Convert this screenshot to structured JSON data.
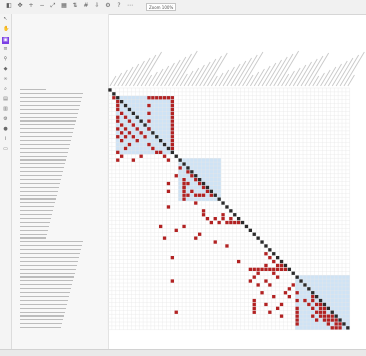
{
  "toolbar": {
    "zoom_value": "Zoom 100%",
    "buttons": [
      "select-icon",
      "pan-icon",
      "zoom-in-icon",
      "zoom-out-icon",
      "fit-icon",
      "cluster-icon",
      "sort-icon",
      "grid-icon",
      "export-icon",
      "settings-icon",
      "help-icon",
      "more-icon"
    ]
  },
  "sidebar": {
    "icons": [
      "pointer-icon",
      "hand-icon",
      "matrix-icon",
      "layers-icon",
      "filter-icon",
      "tag-icon",
      "link-icon",
      "search-icon",
      "chart-icon",
      "table-icon",
      "gear-icon",
      "user-icon",
      "info-icon",
      "folder-icon"
    ],
    "active_index": 2
  },
  "status": {
    "text": ""
  },
  "colors": {
    "mark": "#b22222",
    "diagonal": "#2b2b2b",
    "cluster": "#cfe3f5",
    "grid": "#e7e7e7"
  },
  "matrix": {
    "n": 62,
    "marks": [
      [
        2,
        1
      ],
      [
        3,
        2
      ],
      [
        4,
        2
      ],
      [
        5,
        2
      ],
      [
        6,
        3
      ],
      [
        7,
        2
      ],
      [
        7,
        4
      ],
      [
        8,
        2
      ],
      [
        8,
        5
      ],
      [
        9,
        3
      ],
      [
        9,
        6
      ],
      [
        10,
        2
      ],
      [
        10,
        4
      ],
      [
        10,
        7
      ],
      [
        11,
        3
      ],
      [
        11,
        5
      ],
      [
        11,
        8
      ],
      [
        12,
        2
      ],
      [
        12,
        4
      ],
      [
        12,
        6
      ],
      [
        12,
        9
      ],
      [
        13,
        3
      ],
      [
        13,
        7
      ],
      [
        14,
        5
      ],
      [
        14,
        10
      ],
      [
        15,
        4
      ],
      [
        15,
        11
      ],
      [
        16,
        2
      ],
      [
        16,
        12
      ],
      [
        16,
        13
      ],
      [
        17,
        3
      ],
      [
        17,
        8
      ],
      [
        17,
        14
      ],
      [
        18,
        2
      ],
      [
        18,
        6
      ],
      [
        18,
        15
      ],
      [
        10,
        10
      ],
      [
        8,
        10
      ],
      [
        6,
        10
      ],
      [
        4,
        10
      ],
      [
        2,
        10
      ],
      [
        2,
        11
      ],
      [
        2,
        12
      ],
      [
        2,
        13
      ],
      [
        2,
        14
      ],
      [
        2,
        15
      ],
      [
        2,
        16
      ],
      [
        3,
        16
      ],
      [
        4,
        16
      ],
      [
        5,
        16
      ],
      [
        6,
        16
      ],
      [
        7,
        16
      ],
      [
        8,
        16
      ],
      [
        9,
        16
      ],
      [
        10,
        16
      ],
      [
        11,
        16
      ],
      [
        12,
        16
      ],
      [
        13,
        16
      ],
      [
        14,
        16
      ],
      [
        15,
        16
      ],
      [
        21,
        20
      ],
      [
        22,
        21
      ],
      [
        23,
        19
      ],
      [
        23,
        22
      ],
      [
        24,
        20
      ],
      [
        24,
        23
      ],
      [
        25,
        19
      ],
      [
        25,
        24
      ],
      [
        26,
        21
      ],
      [
        26,
        25
      ],
      [
        27,
        19
      ],
      [
        27,
        20
      ],
      [
        27,
        26
      ],
      [
        26,
        19
      ],
      [
        25,
        19
      ],
      [
        24,
        19
      ],
      [
        27,
        22
      ],
      [
        27,
        23
      ],
      [
        27,
        24
      ],
      [
        20,
        18
      ],
      [
        22,
        17
      ],
      [
        24,
        15
      ],
      [
        26,
        15
      ],
      [
        28,
        19
      ],
      [
        29,
        22
      ],
      [
        30,
        15
      ],
      [
        31,
        24
      ],
      [
        32,
        24
      ],
      [
        32,
        29
      ],
      [
        33,
        25
      ],
      [
        33,
        31
      ],
      [
        34,
        26
      ],
      [
        34,
        32
      ],
      [
        33,
        27
      ],
      [
        34,
        28
      ],
      [
        33,
        29
      ],
      [
        34,
        30
      ],
      [
        34,
        31
      ],
      [
        34,
        33
      ],
      [
        35,
        19
      ],
      [
        37,
        23
      ],
      [
        38,
        22
      ],
      [
        39,
        27
      ],
      [
        40,
        30
      ],
      [
        36,
        17
      ],
      [
        43,
        41
      ],
      [
        42,
        40
      ],
      [
        44,
        42
      ],
      [
        45,
        40
      ],
      [
        45,
        43
      ],
      [
        45,
        44
      ],
      [
        46,
        41
      ],
      [
        47,
        38
      ],
      [
        48,
        37
      ],
      [
        49,
        36
      ],
      [
        46,
        36
      ],
      [
        46,
        37
      ],
      [
        46,
        38
      ],
      [
        46,
        39
      ],
      [
        46,
        40
      ],
      [
        46,
        42
      ],
      [
        46,
        43
      ],
      [
        46,
        44
      ],
      [
        46,
        45
      ],
      [
        44,
        33
      ],
      [
        47,
        42
      ],
      [
        48,
        43
      ],
      [
        49,
        40
      ],
      [
        50,
        41
      ],
      [
        51,
        46
      ],
      [
        52,
        45
      ],
      [
        53,
        46
      ],
      [
        54,
        50
      ],
      [
        55,
        51
      ],
      [
        56,
        52
      ],
      [
        57,
        53
      ],
      [
        55,
        53
      ],
      [
        56,
        54
      ],
      [
        57,
        54
      ],
      [
        57,
        55
      ],
      [
        58,
        54
      ],
      [
        58,
        55
      ],
      [
        58,
        56
      ],
      [
        58,
        57
      ],
      [
        59,
        55
      ],
      [
        59,
        57
      ],
      [
        59,
        58
      ],
      [
        60,
        56
      ],
      [
        60,
        59
      ],
      [
        61,
        57
      ],
      [
        61,
        58
      ],
      [
        61,
        59
      ],
      [
        60,
        58
      ],
      [
        59,
        56
      ],
      [
        56,
        55
      ],
      [
        55,
        54
      ],
      [
        54,
        52
      ],
      [
        53,
        52
      ],
      [
        58,
        52
      ],
      [
        59,
        53
      ],
      [
        56,
        48
      ],
      [
        57,
        48
      ],
      [
        58,
        48
      ],
      [
        59,
        48
      ],
      [
        60,
        48
      ],
      [
        54,
        48
      ],
      [
        52,
        48
      ],
      [
        50,
        47
      ],
      [
        54,
        37
      ],
      [
        55,
        37
      ],
      [
        56,
        37
      ],
      [
        57,
        37
      ],
      [
        50,
        38
      ],
      [
        52,
        39
      ],
      [
        55,
        40
      ],
      [
        57,
        41
      ],
      [
        53,
        42
      ],
      [
        55,
        44
      ],
      [
        56,
        43
      ],
      [
        58,
        44
      ],
      [
        43,
        16
      ],
      [
        49,
        16
      ],
      [
        57,
        17
      ],
      [
        35,
        13
      ],
      [
        38,
        14
      ]
    ],
    "clusters": [
      [
        2,
        16
      ],
      [
        18,
        28
      ],
      [
        48,
        61
      ]
    ]
  }
}
